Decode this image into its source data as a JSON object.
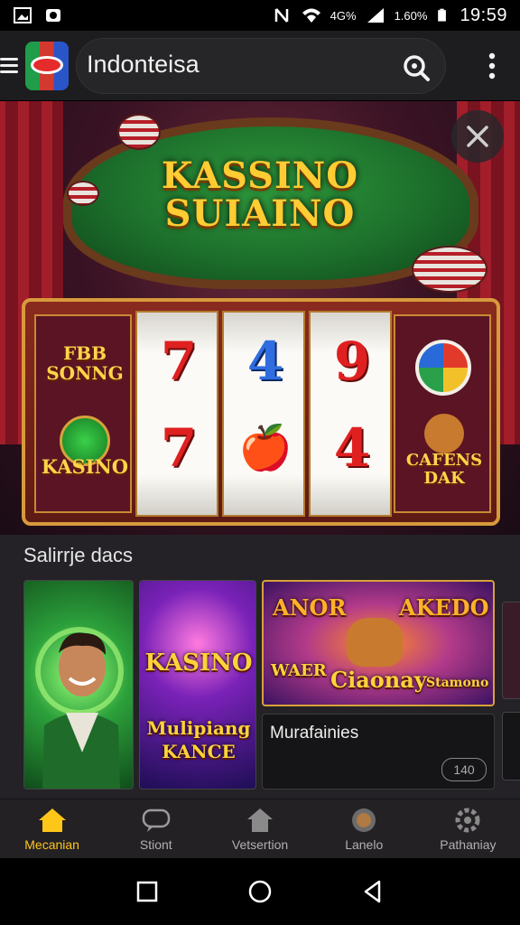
{
  "status_bar": {
    "network_text": "4G%",
    "battery_text": "1.60%",
    "time": "19:59"
  },
  "app_bar": {
    "title": "Indonteisa",
    "icons": [
      "menu-icon",
      "app-logo",
      "search-icon",
      "more-vert-icon"
    ]
  },
  "hero": {
    "title_line1": "KASSINO",
    "title_line2": "SUIAINO",
    "left_panel_top": "FBB SONNG",
    "left_panel_bottom": "KASINO",
    "right_panel_bottom": "CAFENS DAK",
    "reels": [
      {
        "top": "7",
        "bottom": "7"
      },
      {
        "top": "4",
        "bottom": "🍎"
      },
      {
        "top": "9",
        "bottom": "4"
      }
    ]
  },
  "section": {
    "title": "Salirrje dacs",
    "cards": [
      {
        "title": ""
      },
      {
        "title_top": "KASINO",
        "title_bottom": "Mulipiang KANCE"
      },
      {
        "title_left": "ANOR",
        "title_right": "AKEDO",
        "sub_left": "WAER",
        "sub_mid": "Ciaonay",
        "sub_right": "Stamono"
      },
      {
        "title": "Murafainies",
        "badge": "140"
      }
    ]
  },
  "bottom_nav": [
    {
      "label": "Mecanian",
      "icon": "home-icon",
      "active": true
    },
    {
      "label": "Stiont",
      "icon": "chat-icon",
      "active": false
    },
    {
      "label": "Vetsertion",
      "icon": "tag-icon",
      "active": false
    },
    {
      "label": "Lanelo",
      "icon": "profile-icon",
      "active": false
    },
    {
      "label": "Pathaniay",
      "icon": "settings-icon",
      "active": false
    }
  ],
  "colors": {
    "accent": "#ffc61a",
    "app_bar_bg": "#1d1c1e",
    "nav_bg": "#232124"
  }
}
